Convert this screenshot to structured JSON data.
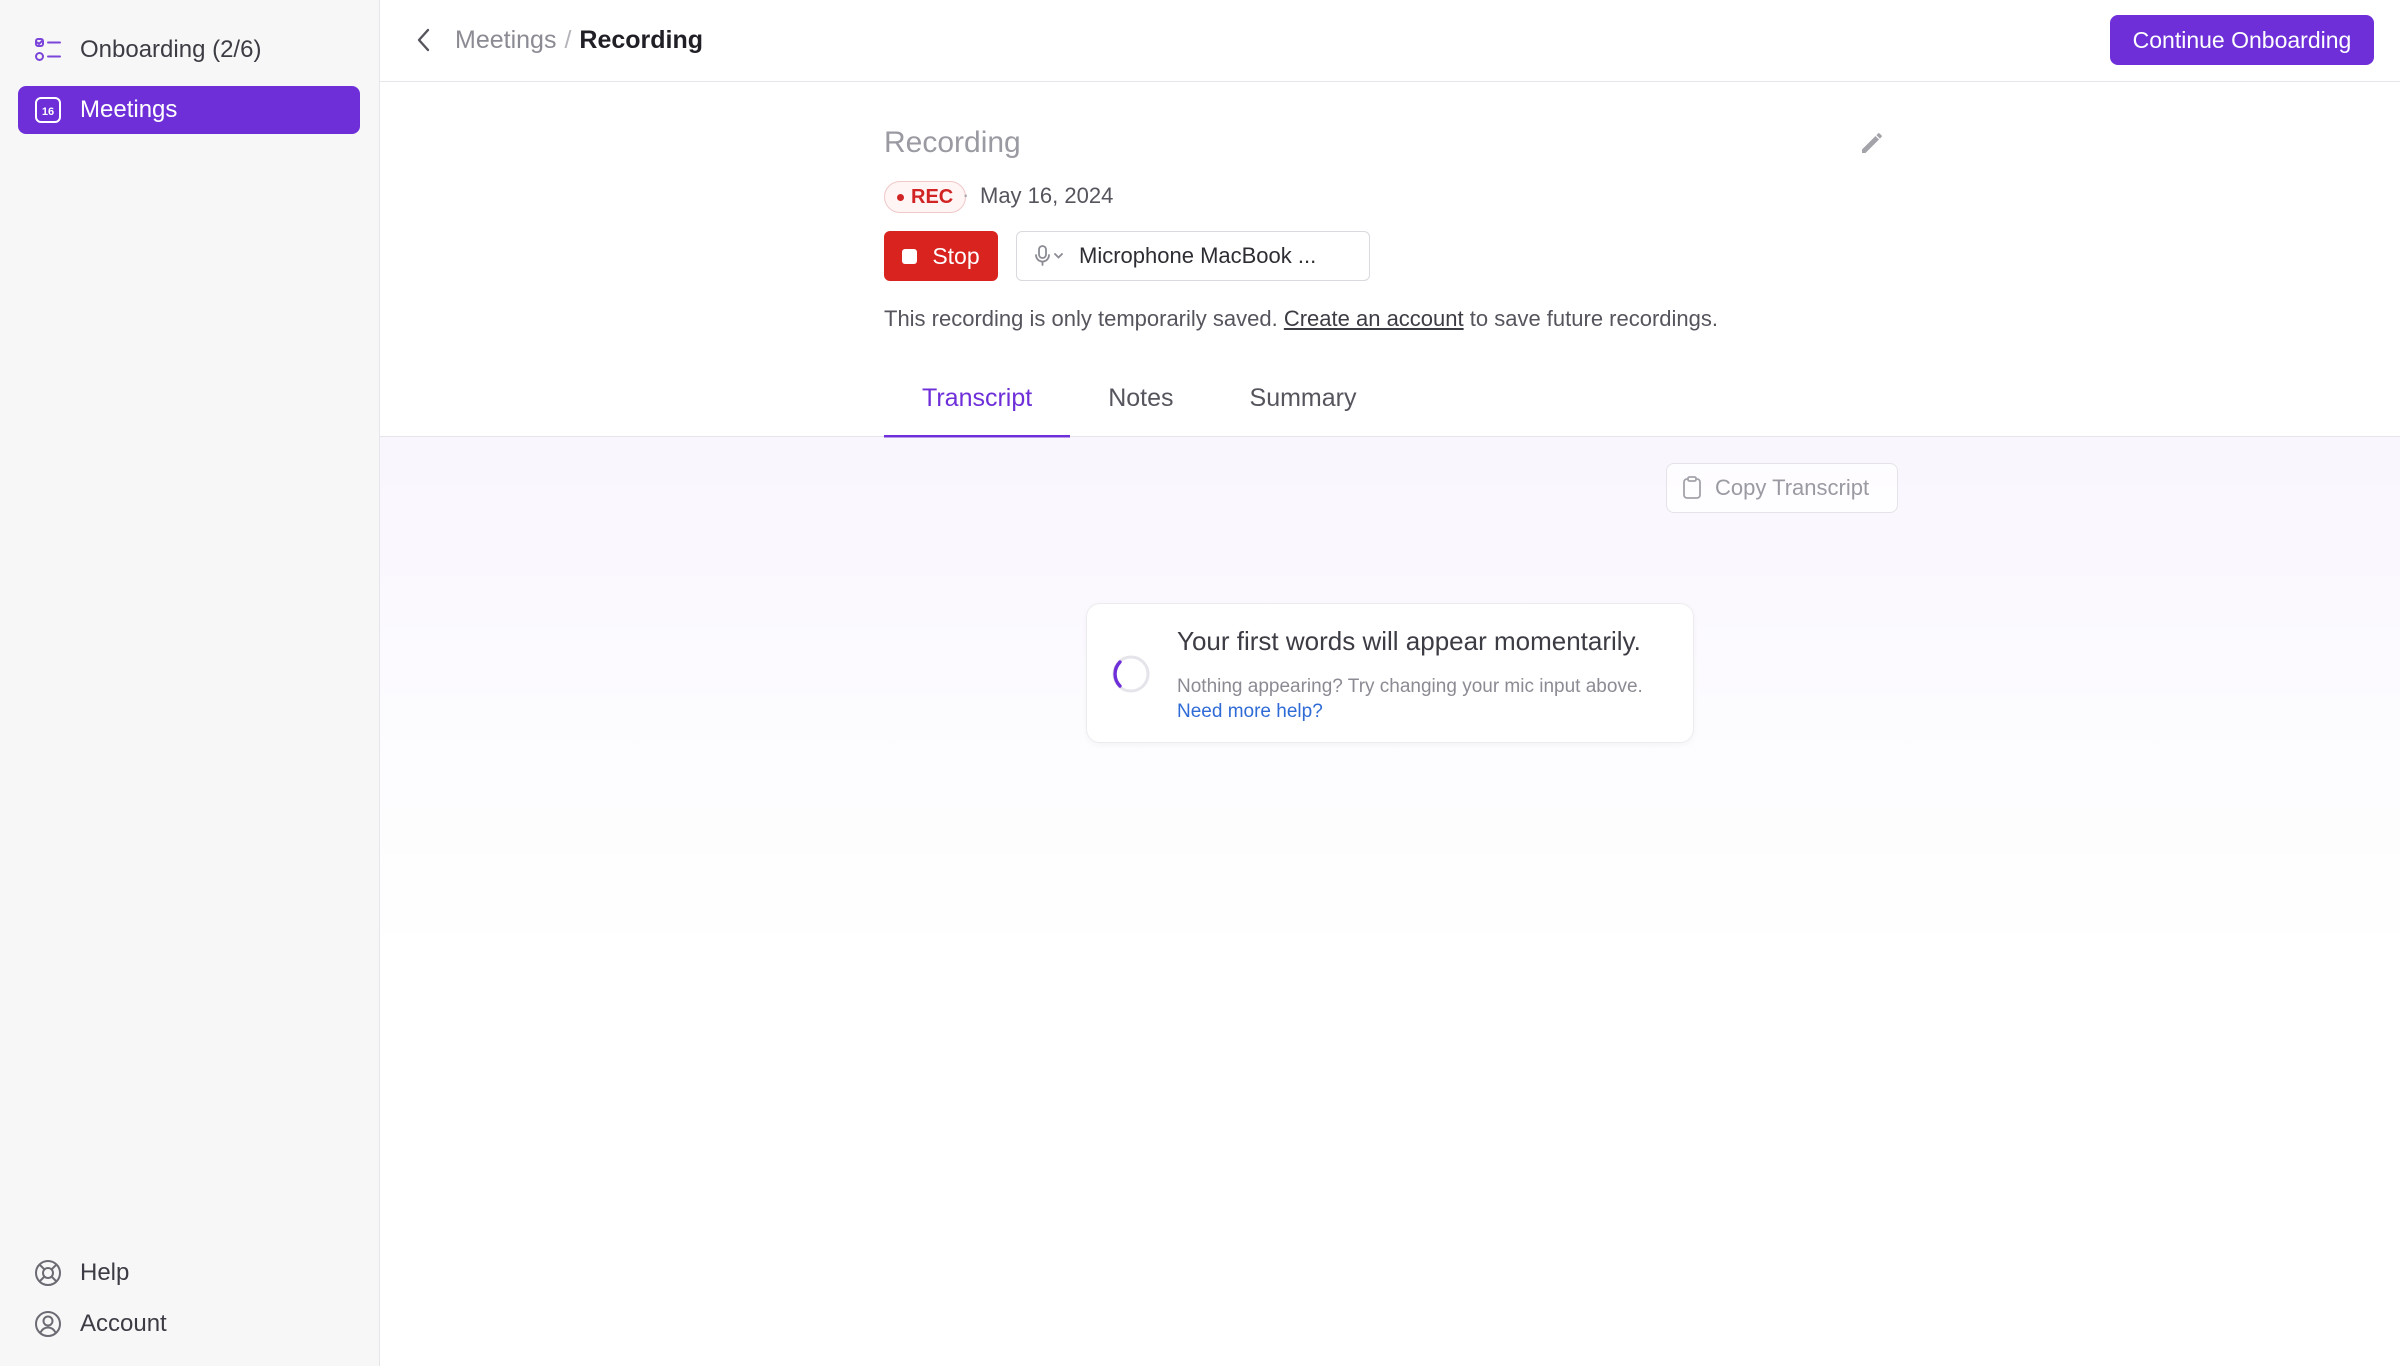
{
  "sidebar": {
    "items": [
      {
        "label": "Onboarding (2/6)",
        "icon": "checklist-icon"
      },
      {
        "label": "Meetings",
        "icon": "calendar-icon",
        "icon_text": "16"
      }
    ],
    "footer": [
      {
        "label": "Help",
        "icon": "lifebuoy-icon"
      },
      {
        "label": "Account",
        "icon": "user-circle-icon"
      }
    ]
  },
  "topbar": {
    "breadcrumb_parent": "Meetings",
    "breadcrumb_sep": "/",
    "breadcrumb_current": "Recording",
    "continue_label": "Continue Onboarding"
  },
  "recording": {
    "title": "Recording",
    "rec_label": "REC",
    "meta_sep": "·",
    "date": "May 16, 2024",
    "stop_label": "Stop",
    "mic_value": "Microphone MacBook ...",
    "notice_before": "This recording is only temporarily saved.",
    "notice_link": "Create an account",
    "notice_after": "to save future recordings."
  },
  "tabs": [
    {
      "label": "Transcript",
      "active": true
    },
    {
      "label": "Notes",
      "active": false
    },
    {
      "label": "Summary",
      "active": false
    }
  ],
  "transcript": {
    "copy_label": "Copy Transcript",
    "waiting_title": "Your first words will appear momentarily.",
    "waiting_sub": "Nothing appearing? Try changing your mic input above.",
    "help_link": "Need more help?"
  },
  "colors": {
    "accent": "#6e2fd9",
    "stop": "#d8231f",
    "link": "#2f6bd6"
  }
}
